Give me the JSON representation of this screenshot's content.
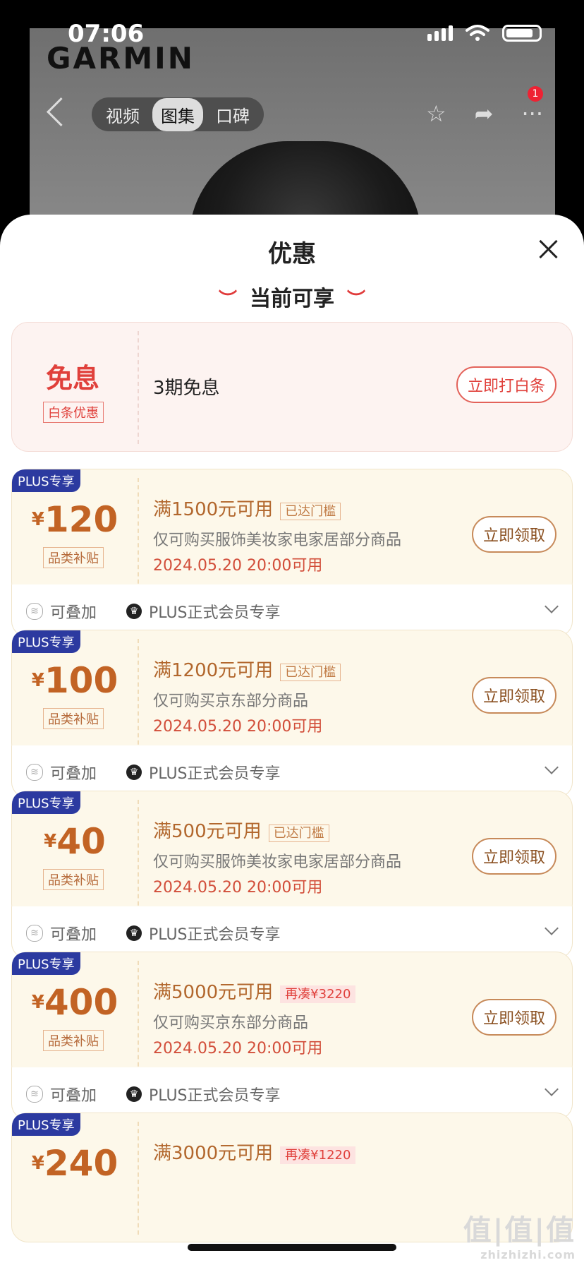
{
  "status": {
    "time": "07:06"
  },
  "background": {
    "brand": "GARMIN"
  },
  "topbar": {
    "tabs": [
      "视频",
      "图集",
      "口碑"
    ],
    "active_tab": "图集",
    "notification_count": "1"
  },
  "sheet": {
    "title": "优惠",
    "subtitle": "当前可享",
    "baitiao": {
      "title": "免息",
      "tag": "白条优惠",
      "desc": "3期免息",
      "button": "立即打白条"
    },
    "coupons": [
      {
        "plus_tag": "PLUS专享",
        "currency": "¥",
        "amount": "120",
        "category": "品类补贴",
        "condition": "满1500元可用",
        "chip": "已达门槛",
        "chip_type": "ok",
        "scope": "仅可购买服饰美妆家电家居部分商品",
        "time": "2024.05.20 20:00可用",
        "button": "立即领取",
        "foot_stack": "可叠加",
        "foot_plus": "PLUS正式会员专享"
      },
      {
        "plus_tag": "PLUS专享",
        "currency": "¥",
        "amount": "100",
        "category": "品类补贴",
        "condition": "满1200元可用",
        "chip": "已达门槛",
        "chip_type": "ok",
        "scope": "仅可购买京东部分商品",
        "time": "2024.05.20 20:00可用",
        "button": "立即领取",
        "foot_stack": "可叠加",
        "foot_plus": "PLUS正式会员专享"
      },
      {
        "plus_tag": "PLUS专享",
        "currency": "¥",
        "amount": "40",
        "category": "品类补贴",
        "condition": "满500元可用",
        "chip": "已达门槛",
        "chip_type": "ok",
        "scope": "仅可购买服饰美妆家电家居部分商品",
        "time": "2024.05.20 20:00可用",
        "button": "立即领取",
        "foot_stack": "可叠加",
        "foot_plus": "PLUS正式会员专享"
      },
      {
        "plus_tag": "PLUS专享",
        "currency": "¥",
        "amount": "400",
        "category": "品类补贴",
        "condition": "满5000元可用",
        "chip": "再凑¥3220",
        "chip_type": "red",
        "scope": "仅可购买京东部分商品",
        "time": "2024.05.20 20:00可用",
        "button": "立即领取",
        "foot_stack": "可叠加",
        "foot_plus": "PLUS正式会员专享"
      },
      {
        "plus_tag": "PLUS专享",
        "currency": "¥",
        "amount": "240",
        "category": "",
        "condition": "满3000元可用",
        "chip": "再凑¥1220",
        "chip_type": "red",
        "scope": "",
        "time": "",
        "button": "",
        "foot_stack": "",
        "foot_plus": ""
      }
    ]
  },
  "watermark": {
    "main": "值|值|值",
    "sub": "zhizhizhi.com"
  }
}
